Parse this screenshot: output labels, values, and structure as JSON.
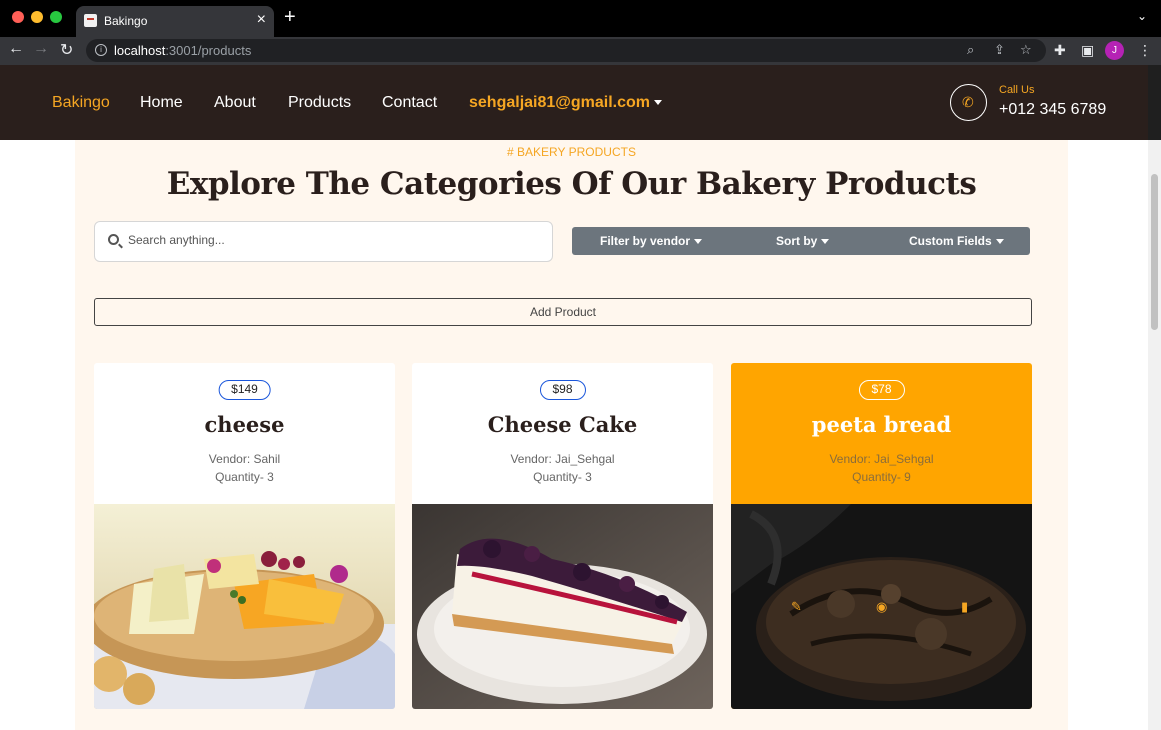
{
  "browser": {
    "tab_title": "Bakingo",
    "tab_close": "×",
    "new_tab": "+",
    "tab_menu": "⌄",
    "url_host": "localhost",
    "url_path": ":3001/products"
  },
  "navbar": {
    "brand": "Bakingo",
    "links": [
      "Home",
      "About",
      "Products",
      "Contact"
    ],
    "user_email": "sehgaljai81@gmail.com",
    "call_label": "Call Us",
    "call_number": "+012 345 6789"
  },
  "page": {
    "eyebrow": "# BAKERY PRODUCTS",
    "heading": "Explore The Categories Of Our Bakery Products",
    "search_placeholder": "Search anything...",
    "filters": {
      "vendor": "Filter by vendor",
      "sort": "Sort by",
      "custom": "Custom Fields"
    },
    "add_product": "Add Product"
  },
  "products": [
    {
      "price": "$149",
      "name": "cheese",
      "vendor": "Vendor: Sahil",
      "quantity": "Quantity- 3"
    },
    {
      "price": "$98",
      "name": "Cheese Cake",
      "vendor": "Vendor: Jai_Sehgal",
      "quantity": "Quantity- 3"
    },
    {
      "price": "$78",
      "name": "peeta bread",
      "vendor": "Vendor: Jai_Sehgal",
      "quantity": "Quantity- 9"
    }
  ],
  "colors": {
    "accent": "#f5a623",
    "navbar_bg": "#2a1f1c",
    "active_card": "#ffa500",
    "filter_bar": "#6c757d"
  }
}
